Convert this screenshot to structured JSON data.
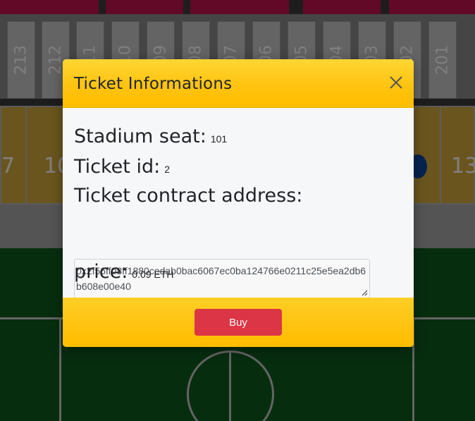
{
  "stadium": {
    "upper_sections": [
      "213",
      "212",
      "211",
      "210",
      "209",
      "208",
      "207",
      "206",
      "205",
      "204",
      "203",
      "202",
      "201"
    ],
    "lower_left_label": "7",
    "lower_left2_label": "10",
    "lower_right_label": "13",
    "colors": {
      "upper_seat": "#c9c9c9",
      "top_block": "#c2124e",
      "lower_seat": "#d6ab3c",
      "field": "#0e5a1e",
      "selected_seat": "#0d47a1"
    }
  },
  "modal": {
    "title": "Ticket Informations",
    "close_icon": "close-icon",
    "stadium_seat_label": "Stadium seat:",
    "stadium_seat_value": "101",
    "ticket_id_label": "Ticket id:",
    "ticket_id_value": "2",
    "contract_address_label": "Ticket contract address:",
    "contract_address_value": "0x2f56ff08ff1880cedab0bac6067ec0ba124766e0211c25e5ea2db6b608e00e40",
    "price_label": "price:",
    "price_value": "0.09 ETH",
    "buy_label": "Buy",
    "colors": {
      "header": "#ffc20e",
      "buy_button": "#dc3545"
    }
  }
}
